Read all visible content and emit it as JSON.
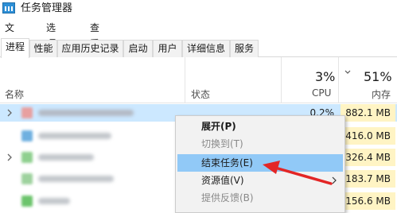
{
  "window": {
    "title": "任务管理器"
  },
  "menu": [
    {
      "label": "文件(F)"
    },
    {
      "label": "选项(O)"
    },
    {
      "label": "查看(V)"
    }
  ],
  "tabs": [
    {
      "label": "进程",
      "active": true
    },
    {
      "label": "性能"
    },
    {
      "label": "应用历史记录"
    },
    {
      "label": "启动"
    },
    {
      "label": "用户"
    },
    {
      "label": "详细信息"
    },
    {
      "label": "服务"
    }
  ],
  "columns": {
    "name": "名称",
    "status": "状态",
    "cpu_pct": "3%",
    "cpu_label": "CPU",
    "mem_pct": "51%",
    "mem_label": "内存"
  },
  "rows": [
    {
      "cpu": "0.2%",
      "memory": "882.1 MB",
      "selected": true,
      "expandable": true,
      "icon_color": "#e8a0a0"
    },
    {
      "cpu": "",
      "memory": "416.0 MB",
      "selected": false,
      "expandable": false,
      "icon_color": "#6fb0e0"
    },
    {
      "cpu": "",
      "memory": "326.4 MB",
      "selected": false,
      "expandable": true,
      "icon_color": "#8fd08f"
    },
    {
      "cpu": "",
      "memory": "183.7 MB",
      "selected": false,
      "expandable": false,
      "icon_color": "#9ed29e"
    },
    {
      "cpu": "",
      "memory": "156.6 MB",
      "selected": false,
      "expandable": false,
      "icon_color": "#6cc46c"
    }
  ],
  "context_menu": [
    {
      "label": "展开(P)",
      "bold": true
    },
    {
      "label": "切换到(T)",
      "disabled": true
    },
    {
      "label": "结束任务(E)",
      "hover": true
    },
    {
      "label": "资源值(V)",
      "submenu": true
    },
    {
      "label": "提供反馈(B)",
      "disabled": true
    }
  ],
  "colors": {
    "selection": "#cce8ff",
    "memory_highlight": "#fff4c4",
    "menu_hover": "#91c9f7",
    "annotation_arrow": "#e32626"
  }
}
